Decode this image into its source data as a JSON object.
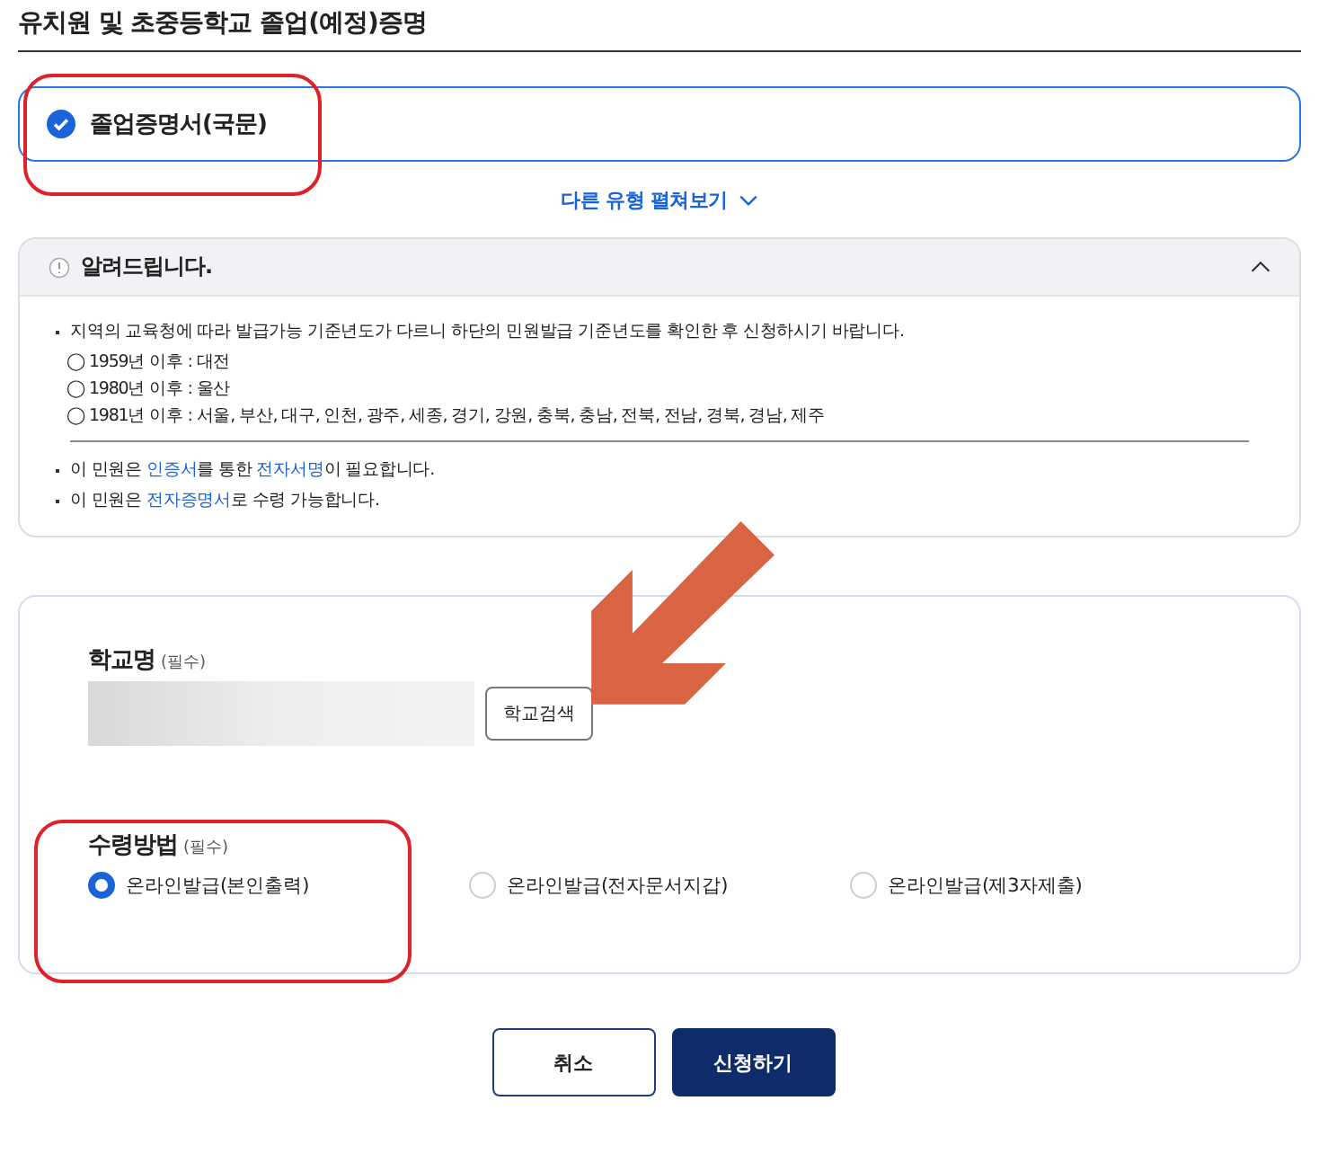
{
  "page_title": "유치원 및 초중등학교 졸업(예정)증명",
  "document_option": {
    "label": "졸업증명서(국문)",
    "selected": true
  },
  "more_types_link": "다른 유형 펼쳐보기",
  "notice": {
    "title": "알려드립니다.",
    "expanded": true,
    "items": [
      {
        "kind": "bullet",
        "parts": [
          {
            "kind": "plain",
            "text": "지역의 교육청에 따라 발급가능 기준년도가 다르니 하단의 민원발급 기준년도를 확인한 후 신청하시기 바랍니다."
          }
        ]
      },
      {
        "kind": "sub",
        "parts": [
          {
            "kind": "plain",
            "text": "◯ 1959년 이후 : 대전"
          }
        ]
      },
      {
        "kind": "sub",
        "parts": [
          {
            "kind": "plain",
            "text": "◯ 1980년 이후 : 울산"
          }
        ]
      },
      {
        "kind": "sub",
        "parts": [
          {
            "kind": "plain",
            "text": "◯ 1981년 이후 : 서울, 부산, 대구, 인천, 광주, 세종, 경기, 강원, 충북, 충남, 전북, 전남, 경북, 경남, 제주"
          }
        ]
      },
      {
        "kind": "divider"
      },
      {
        "kind": "bullet",
        "parts": [
          {
            "kind": "plain",
            "text": "이 민원은 "
          },
          {
            "kind": "link",
            "text": "인증서"
          },
          {
            "kind": "plain",
            "text": "를 통한 "
          },
          {
            "kind": "link",
            "text": "전자서명"
          },
          {
            "kind": "plain",
            "text": "이 필요합니다."
          }
        ]
      },
      {
        "kind": "bullet",
        "parts": [
          {
            "kind": "plain",
            "text": "이 민원은 "
          },
          {
            "kind": "link",
            "text": "전자증명서"
          },
          {
            "kind": "plain",
            "text": "로 수령 가능합니다."
          }
        ]
      }
    ]
  },
  "school": {
    "label": "학교명",
    "required": "(필수)",
    "search_button": "학교검색"
  },
  "receipt": {
    "label": "수령방법",
    "required": "(필수)",
    "options": [
      {
        "label": "온라인발급(본인출력)",
        "selected": true
      },
      {
        "label": "온라인발급(전자문서지갑)",
        "selected": false
      },
      {
        "label": "온라인발급(제3자제출)",
        "selected": false
      }
    ]
  },
  "buttons": [
    {
      "kind": "secondary",
      "label": "취소"
    },
    {
      "kind": "primary",
      "label": "신청하기"
    }
  ]
}
